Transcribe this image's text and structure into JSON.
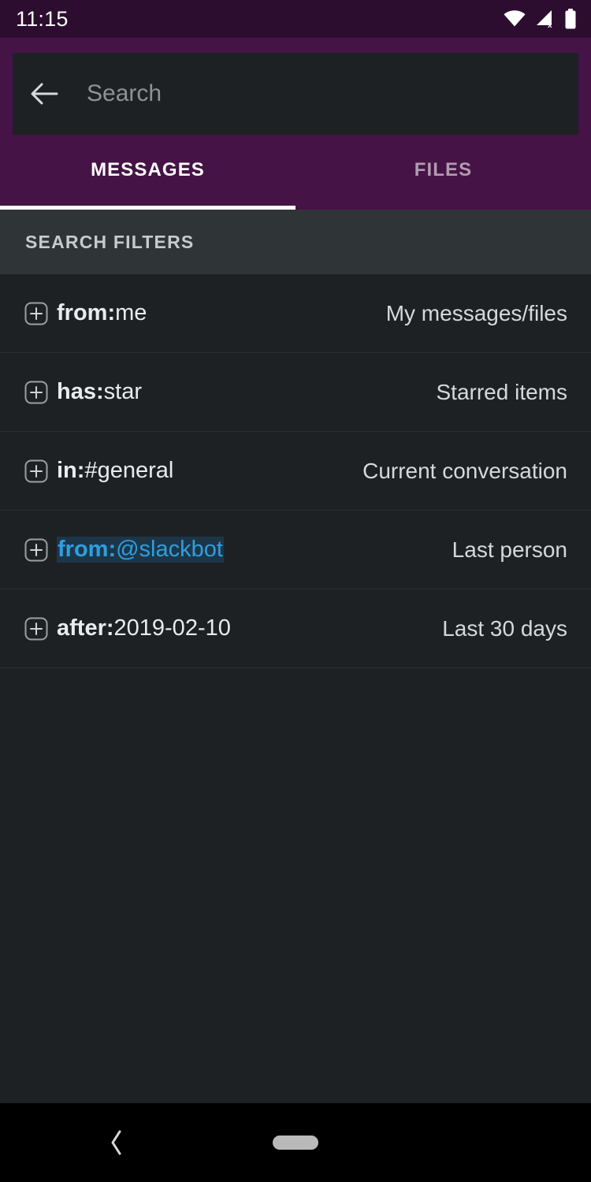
{
  "status_bar": {
    "time": "11:15",
    "icons": [
      {
        "name": "wifi-icon",
        "label": "Wi-Fi connected"
      },
      {
        "name": "cellular-signal-off-icon",
        "label": "No cellular signal"
      },
      {
        "name": "battery-full-icon",
        "label": "Battery full"
      }
    ]
  },
  "header": {
    "back_icon": "arrow-left-icon",
    "search": {
      "value": "",
      "placeholder": "Search"
    },
    "accent_color": "#461347",
    "status_bar_color": "#2d0d2f"
  },
  "tabs": [
    {
      "label": "MESSAGES",
      "active": true
    },
    {
      "label": "FILES",
      "active": false
    }
  ],
  "section": {
    "title": "SEARCH FILTERS"
  },
  "filters": [
    {
      "prefix": "from:",
      "value": "me",
      "description": "My messages/files",
      "highlighted": false,
      "add_icon": "plus-box-icon"
    },
    {
      "prefix": "has:",
      "value": "star",
      "description": "Starred items",
      "highlighted": false,
      "add_icon": "plus-box-icon"
    },
    {
      "prefix": "in:",
      "value": "#general",
      "description": "Current conversation",
      "highlighted": false,
      "add_icon": "plus-box-icon"
    },
    {
      "prefix": "from:",
      "value": "@slackbot",
      "description": "Last person",
      "highlighted": true,
      "add_icon": "plus-box-icon"
    },
    {
      "prefix": "after:",
      "value": "2019-02-10",
      "description": "Last 30 days",
      "highlighted": false,
      "add_icon": "plus-box-icon"
    }
  ],
  "nav_bar": {
    "back_icon": "chevron-left-icon",
    "home_pill": "home-gesture-pill"
  },
  "colors": {
    "highlight_text": "#2f9ee0",
    "highlight_bg": "#1c3648",
    "list_bg": "#1d2124",
    "section_bg": "#2f3437"
  }
}
